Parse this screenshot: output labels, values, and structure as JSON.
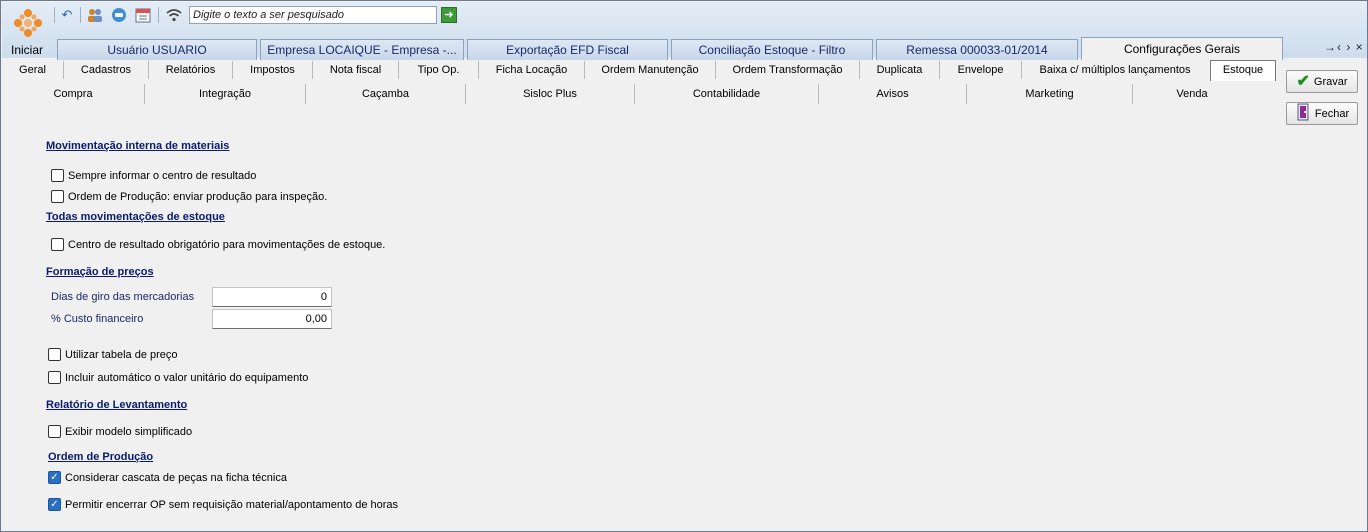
{
  "toolbar": {
    "start_label": "Iniciar",
    "search_placeholder": "Digite o texto a ser pesquisado",
    "icons": [
      "undo-icon",
      "users-icon",
      "chat-icon",
      "calendar-icon",
      "wifi-icon",
      "go-arrow-icon"
    ]
  },
  "doc_tabs": [
    {
      "label": "Usuário USUARIO"
    },
    {
      "label": "Empresa LOCAIQUE - Empresa -..."
    },
    {
      "label": "Exportação EFD Fiscal"
    },
    {
      "label": "Conciliação Estoque - Filtro"
    },
    {
      "label": "Remessa 000033-01/2014"
    },
    {
      "label": "Configurações Gerais"
    }
  ],
  "tab_nav": "→‹ › ×",
  "sub_tabs_row1": [
    {
      "label": "Geral"
    },
    {
      "label": "Cadastros"
    },
    {
      "label": "Relatórios"
    },
    {
      "label": "Impostos"
    },
    {
      "label": "Nota fiscal"
    },
    {
      "label": "Tipo Op."
    },
    {
      "label": "Ficha Locação"
    },
    {
      "label": "Ordem Manutenção"
    },
    {
      "label": "Ordem Transformação"
    },
    {
      "label": "Duplicata"
    },
    {
      "label": "Envelope"
    },
    {
      "label": "Baixa c/ múltiplos lançamentos"
    },
    {
      "label": "Estoque"
    }
  ],
  "sub_tabs_row2": [
    {
      "label": "Compra"
    },
    {
      "label": "Integração"
    },
    {
      "label": "Caçamba"
    },
    {
      "label": "Sisloc Plus"
    },
    {
      "label": "Contabilidade"
    },
    {
      "label": "Avisos"
    },
    {
      "label": "Marketing"
    },
    {
      "label": "Venda"
    }
  ],
  "actions": {
    "save_label": "Gravar",
    "close_label": "Fechar"
  },
  "sections": {
    "mov_interna": {
      "title": "Movimentação interna de materiais",
      "opt1": "Sempre informar o centro de resultado",
      "opt2": "Ordem de Produção: enviar produção para inspeção."
    },
    "todas_mov": {
      "title": "Todas movimentações de estoque",
      "opt1": "Centro de resultado obrigatório para movimentações de estoque."
    },
    "precos": {
      "title": "Formação de preços",
      "dias_label": "Dias de giro das mercadorias",
      "dias_value": "0",
      "custo_label": "% Custo financeiro",
      "custo_value": "0,00",
      "opt1": "Utilizar tabela de preço",
      "opt2": "Incluir automático o valor unitário do equipamento"
    },
    "levantamento": {
      "title": "Relatório de Levantamento",
      "opt1": "Exibir modelo simplificado"
    },
    "producao": {
      "title": "Ordem de Produção",
      "opt1": "Considerar cascata de peças na ficha técnica",
      "opt2": "Permitir encerrar OP sem requisição material/apontamento de horas"
    }
  },
  "colors": {
    "section_title": "#0a1a6e",
    "check_fill": "#2a6fc4",
    "tab_text": "#1a2a68"
  }
}
